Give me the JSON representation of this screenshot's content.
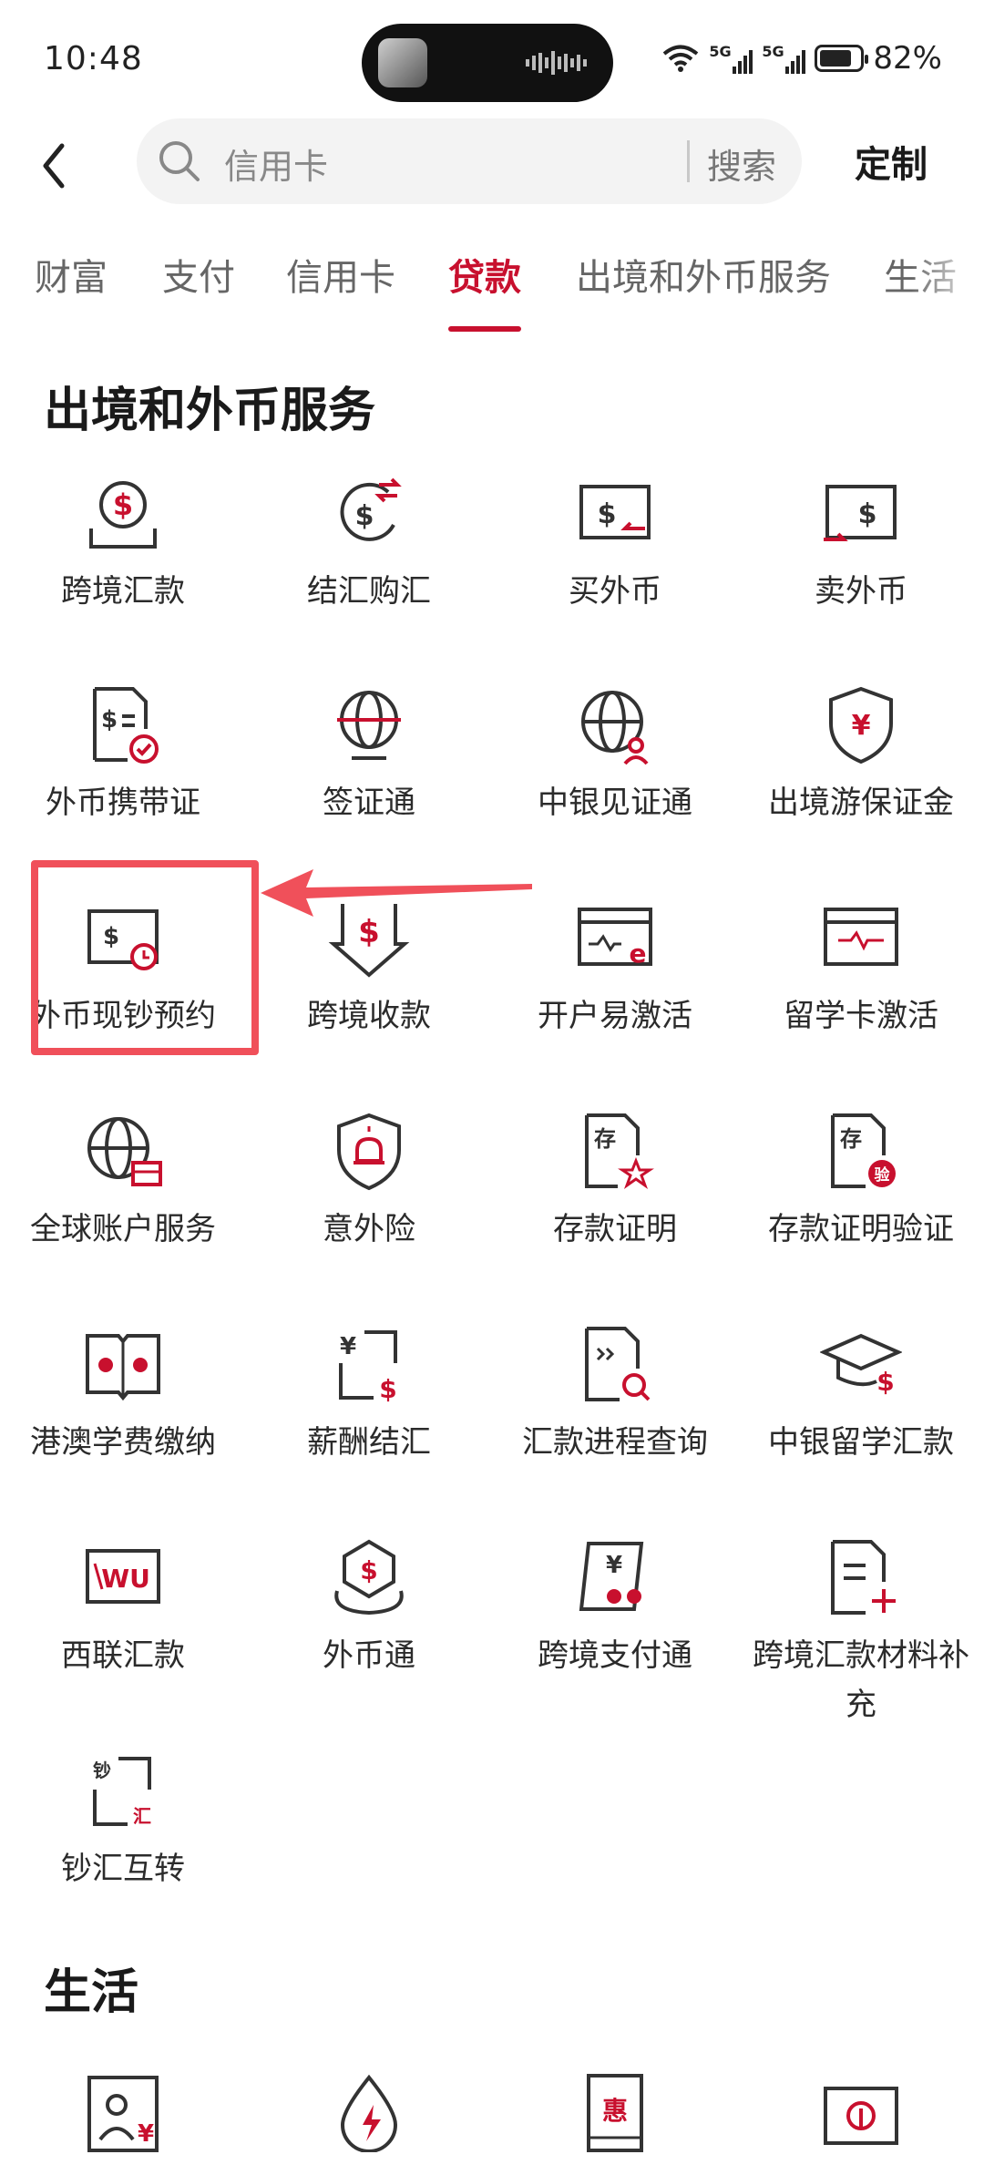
{
  "status_bar": {
    "time": "10:48",
    "signal1": "5G",
    "signal2": "5G",
    "battery_text": "82%",
    "battery_level": 0.82
  },
  "header": {
    "search_placeholder": "信用卡",
    "search_button": "搜索",
    "customize": "定制"
  },
  "tabs": [
    {
      "label": "财富"
    },
    {
      "label": "支付"
    },
    {
      "label": "信用卡"
    },
    {
      "label": "贷款",
      "active": true
    },
    {
      "label": "出境和外币服务"
    },
    {
      "label": "生活"
    }
  ],
  "section_forex": {
    "title": "出境和外币服务",
    "items": [
      {
        "label": "跨境汇款",
        "icon": "cross-border-remit-icon"
      },
      {
        "label": "结汇购汇",
        "icon": "currency-exchange-icon"
      },
      {
        "label": "买外币",
        "icon": "buy-forex-icon"
      },
      {
        "label": "卖外币",
        "icon": "sell-forex-icon"
      },
      {
        "label": "外币携带证",
        "icon": "forex-carry-cert-icon"
      },
      {
        "label": "签证通",
        "icon": "visa-globe-icon"
      },
      {
        "label": "中银见证通",
        "icon": "witness-globe-icon"
      },
      {
        "label": "出境游保证金",
        "icon": "travel-deposit-shield-icon"
      },
      {
        "label": "外币现钞预约",
        "icon": "cash-appointment-icon"
      },
      {
        "label": "跨境收款",
        "icon": "cross-border-receive-icon"
      },
      {
        "label": "开户易激活",
        "icon": "account-activate-icon"
      },
      {
        "label": "留学卡激活",
        "icon": "student-card-activate-icon"
      },
      {
        "label": "全球账户服务",
        "icon": "global-account-icon"
      },
      {
        "label": "意外险",
        "icon": "accident-insurance-icon"
      },
      {
        "label": "存款证明",
        "icon": "deposit-cert-icon"
      },
      {
        "label": "存款证明验证",
        "icon": "deposit-verify-icon"
      },
      {
        "label": "港澳学费缴纳",
        "icon": "hk-macau-tuition-icon"
      },
      {
        "label": "薪酬结汇",
        "icon": "salary-exchange-icon"
      },
      {
        "label": "汇款进程查询",
        "icon": "remit-query-icon"
      },
      {
        "label": "中银留学汇款",
        "icon": "study-abroad-remit-icon"
      },
      {
        "label": "西联汇款",
        "icon": "western-union-icon"
      },
      {
        "label": "外币通",
        "icon": "forex-pass-icon"
      },
      {
        "label": "跨境支付通",
        "icon": "cross-border-pay-icon"
      },
      {
        "label": "跨境汇款材料补充",
        "icon": "remit-material-add-icon"
      },
      {
        "label": "钞汇互转",
        "icon": "cash-remit-convert-icon"
      }
    ]
  },
  "section_life": {
    "title": "生活",
    "icons": [
      "life-id-yuan-icon",
      "life-power-drop-icon",
      "life-discount-phone-icon",
      "life-card-icon"
    ]
  }
}
